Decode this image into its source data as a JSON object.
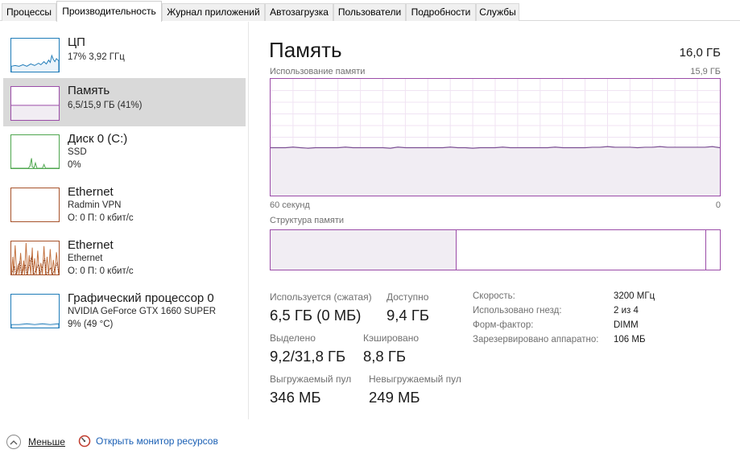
{
  "tabs": [
    {
      "label": "Процессы",
      "active": false
    },
    {
      "label": "Производительность",
      "active": true
    },
    {
      "label": "Журнал приложений",
      "active": false
    },
    {
      "label": "Автозагрузка",
      "active": false
    },
    {
      "label": "Пользователи",
      "active": false
    },
    {
      "label": "Подробности",
      "active": false
    },
    {
      "label": "Службы",
      "active": false
    }
  ],
  "sidebar": {
    "items": [
      {
        "title": "ЦП",
        "line1": "17% 3,92 ГГц",
        "line2": "",
        "color": "#1e7bb8",
        "selected": false
      },
      {
        "title": "Память",
        "line1": "6,5/15,9 ГБ (41%)",
        "line2": "",
        "color": "#9b4ca8",
        "selected": true
      },
      {
        "title": "Диск 0 (C:)",
        "line1": "SSD",
        "line2": "0%",
        "color": "#4da64d",
        "selected": false
      },
      {
        "title": "Ethernet",
        "line1": "Radmin VPN",
        "line2": "О: 0 П: 0 кбит/с",
        "color": "#a7522a",
        "selected": false
      },
      {
        "title": "Ethernet",
        "line1": "Ethernet",
        "line2": "О: 0 П: 0 кбит/с",
        "color": "#a7522a",
        "selected": false
      },
      {
        "title": "Графический процессор 0",
        "line1": "NVIDIA GeForce GTX 1660 SUPER",
        "line2": "9% (49 °C)",
        "color": "#1e7bb8",
        "selected": false
      }
    ]
  },
  "memory": {
    "title": "Память",
    "total": "16,0 ГБ",
    "usage_label": "Использование памяти",
    "usage_max": "15,9 ГБ",
    "time_left": "60 секунд",
    "time_right": "0",
    "usage_fraction": 0.41,
    "structure_label": "Структура памяти",
    "stats": {
      "in_use_label": "Используется (сжатая)",
      "in_use_value": "6,5 ГБ (0 МБ)",
      "available_label": "Доступно",
      "available_value": "9,4 ГБ",
      "committed_label": "Выделено",
      "committed_value": "9,2/31,8 ГБ",
      "cached_label": "Кэшировано",
      "cached_value": "8,8 ГБ",
      "paged_label": "Выгружаемый пул",
      "paged_value": "346 МБ",
      "nonpaged_label": "Невыгружаемый пул",
      "nonpaged_value": "249 МБ"
    },
    "specs": {
      "speed_label": "Скорость:",
      "speed_value": "3200 МГц",
      "slots_label": "Использовано гнезд:",
      "slots_value": "2 из 4",
      "form_label": "Форм-фактор:",
      "form_value": "DIMM",
      "reserved_label": "Зарезервировано аппаратно:",
      "reserved_value": "106 МБ"
    }
  },
  "footer": {
    "less_label": "Меньше",
    "resmon_label": "Открыть монитор ресурсов"
  },
  "colors": {
    "memory": "#9b4ca8",
    "cpu": "#1e7bb8",
    "disk": "#4da64d",
    "network": "#a7522a",
    "link": "#1a5fb4"
  }
}
